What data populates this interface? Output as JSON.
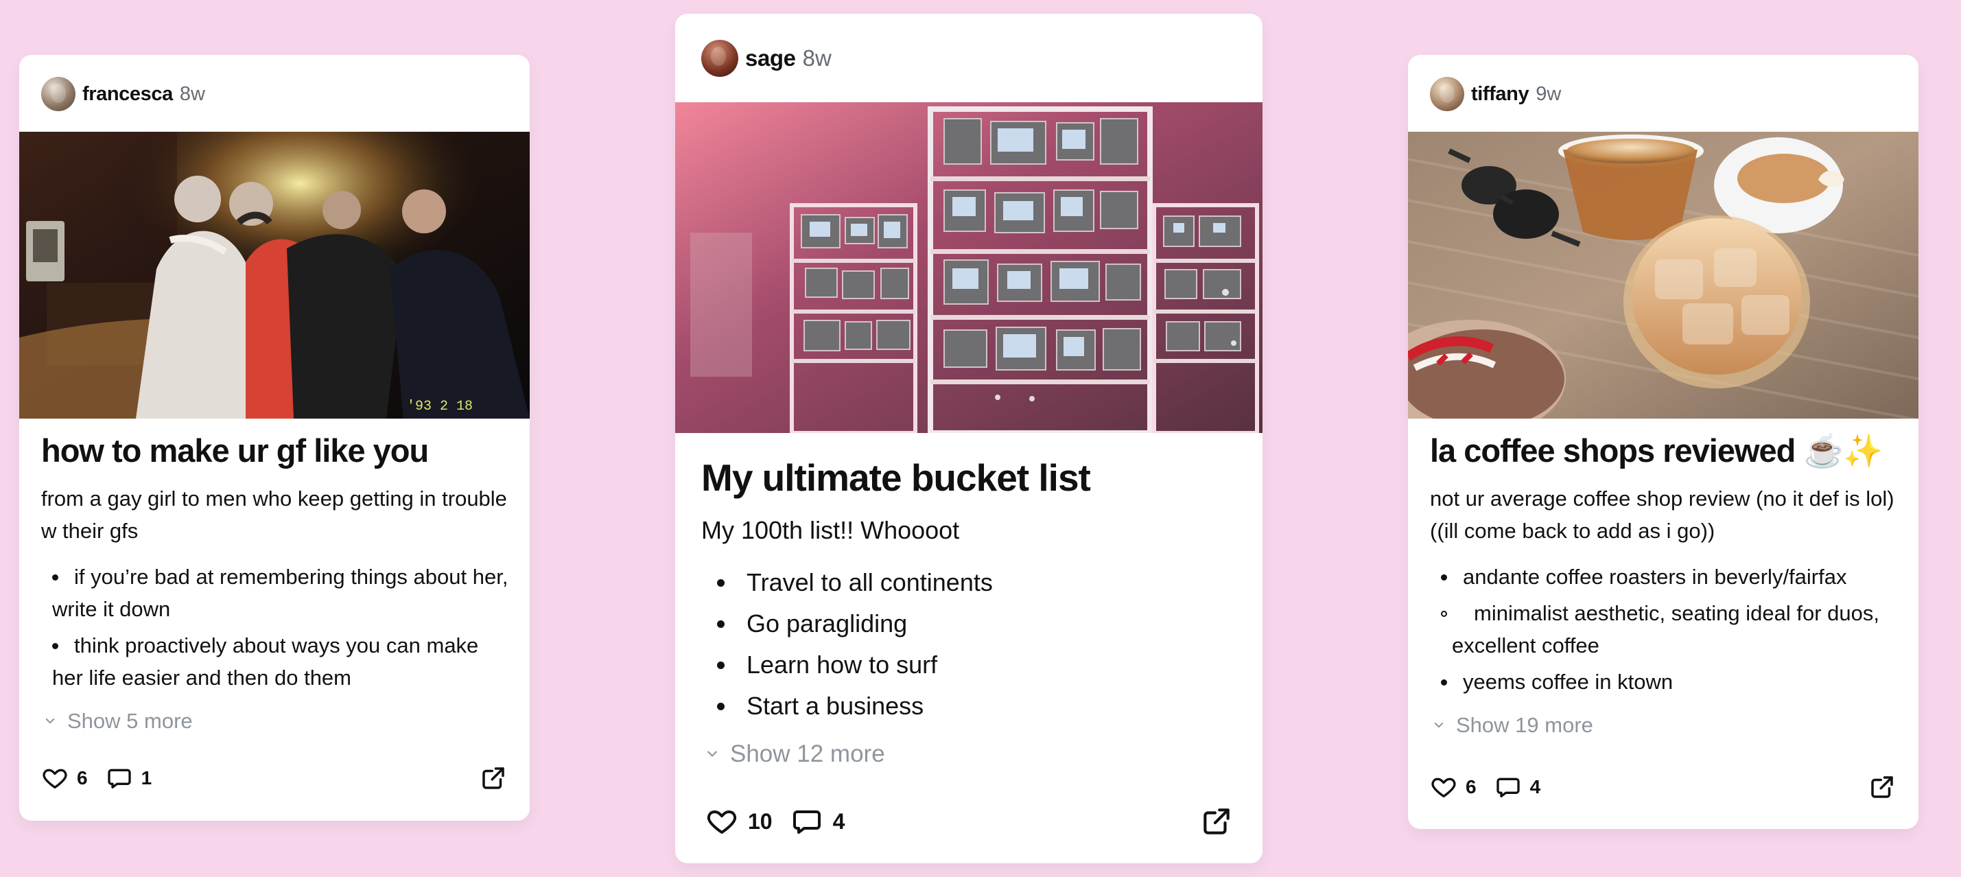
{
  "cards": [
    {
      "username": "francesca",
      "timestamp": "8w",
      "title": "how to make ur gf like you",
      "subtitle": "from a gay girl to men who keep getting in trouble w their gfs",
      "items": [
        "if you’re bad at remembering things about her, write it down",
        "think proactively about ways you can make her life easier and then do them"
      ],
      "show_more": "Show 5 more",
      "likes": "6",
      "comments": "1",
      "image_desc": "party-photo",
      "image_caption": "'93 2 18"
    },
    {
      "username": "sage",
      "timestamp": "8w",
      "title": "My ultimate bucket list",
      "subtitle": "My 100th list!! Whoooot",
      "items": [
        "Travel to all continents",
        "Go paragliding",
        "Learn how to surf",
        "Start a business"
      ],
      "show_more": "Show 12 more",
      "likes": "10",
      "comments": "4",
      "image_desc": "retro-tv-wall"
    },
    {
      "username": "tiffany",
      "timestamp": "9w",
      "title": "la coffee shops reviewed ☕️✨",
      "subtitle": "not ur average coffee shop review (no it def is lol) ((ill come back to add as i go))",
      "items": [
        "andante coffee roasters in beverly/fairfax",
        "minimalist aesthetic, seating ideal for duos, excellent coffee",
        "yeems coffee in ktown"
      ],
      "show_more": "Show 19 more",
      "likes": "6",
      "comments": "4",
      "image_desc": "iced-coffee-table"
    }
  ],
  "colors": {
    "background": "#f7d6ec",
    "card": "#ffffff",
    "text": "#111111",
    "muted": "#8f959d"
  }
}
